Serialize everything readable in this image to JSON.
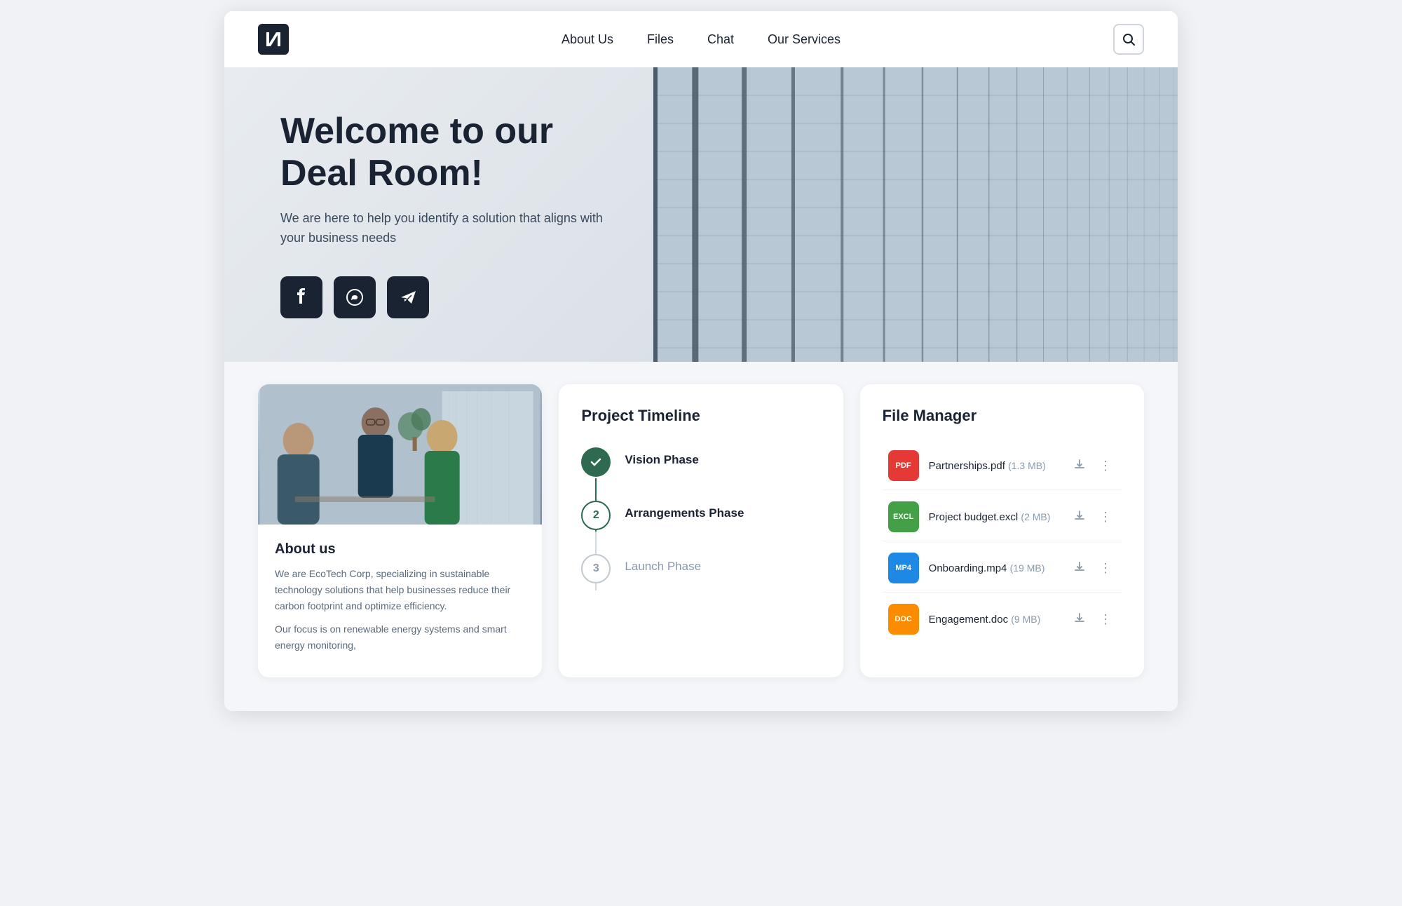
{
  "meta": {
    "title": "Deal Room"
  },
  "navbar": {
    "logo_text": "N",
    "links": [
      {
        "id": "about-us",
        "label": "About Us"
      },
      {
        "id": "files",
        "label": "Files"
      },
      {
        "id": "chat",
        "label": "Chat"
      },
      {
        "id": "our-services",
        "label": "Our Services"
      }
    ],
    "search_label": "🔍"
  },
  "hero": {
    "title": "Welcome to our Deal Room!",
    "subtitle": "We are here to help you identify a solution that aligns with your business needs",
    "social_buttons": [
      {
        "id": "facebook",
        "icon": "f",
        "label": "Facebook"
      },
      {
        "id": "whatsapp",
        "icon": "📞",
        "label": "WhatsApp"
      },
      {
        "id": "telegram",
        "icon": "✈",
        "label": "Telegram"
      }
    ]
  },
  "about": {
    "title": "About us",
    "paragraphs": [
      "We are EcoTech Corp, specializing in sustainable technology solutions that help businesses reduce their carbon footprint and optimize efficiency.",
      "Our focus is on renewable energy systems and smart energy monitoring,"
    ]
  },
  "timeline": {
    "title": "Project Timeline",
    "phases": [
      {
        "id": 1,
        "label": "Vision Phase",
        "status": "completed",
        "node": "✓"
      },
      {
        "id": 2,
        "label": "Arrangements Phase",
        "status": "active",
        "node": "2"
      },
      {
        "id": 3,
        "label": "Launch Phase",
        "status": "inactive",
        "node": "3"
      }
    ]
  },
  "fileManager": {
    "title": "File Manager",
    "files": [
      {
        "id": 1,
        "name": "Partnerships.pdf",
        "size": "1.3 MB",
        "badge": "PDF",
        "badge_class": "badge-pdf"
      },
      {
        "id": 2,
        "name": "Project budget.excl",
        "size": "2 MB",
        "badge": "EXCL",
        "badge_class": "badge-excl"
      },
      {
        "id": 3,
        "name": "Onboarding.mp4",
        "size": "19 MB",
        "badge": "MP4",
        "badge_class": "badge-mp4"
      },
      {
        "id": 4,
        "name": "Engagement.doc",
        "size": "9 MB",
        "badge": "DOC",
        "badge_class": "badge-doc"
      }
    ]
  }
}
